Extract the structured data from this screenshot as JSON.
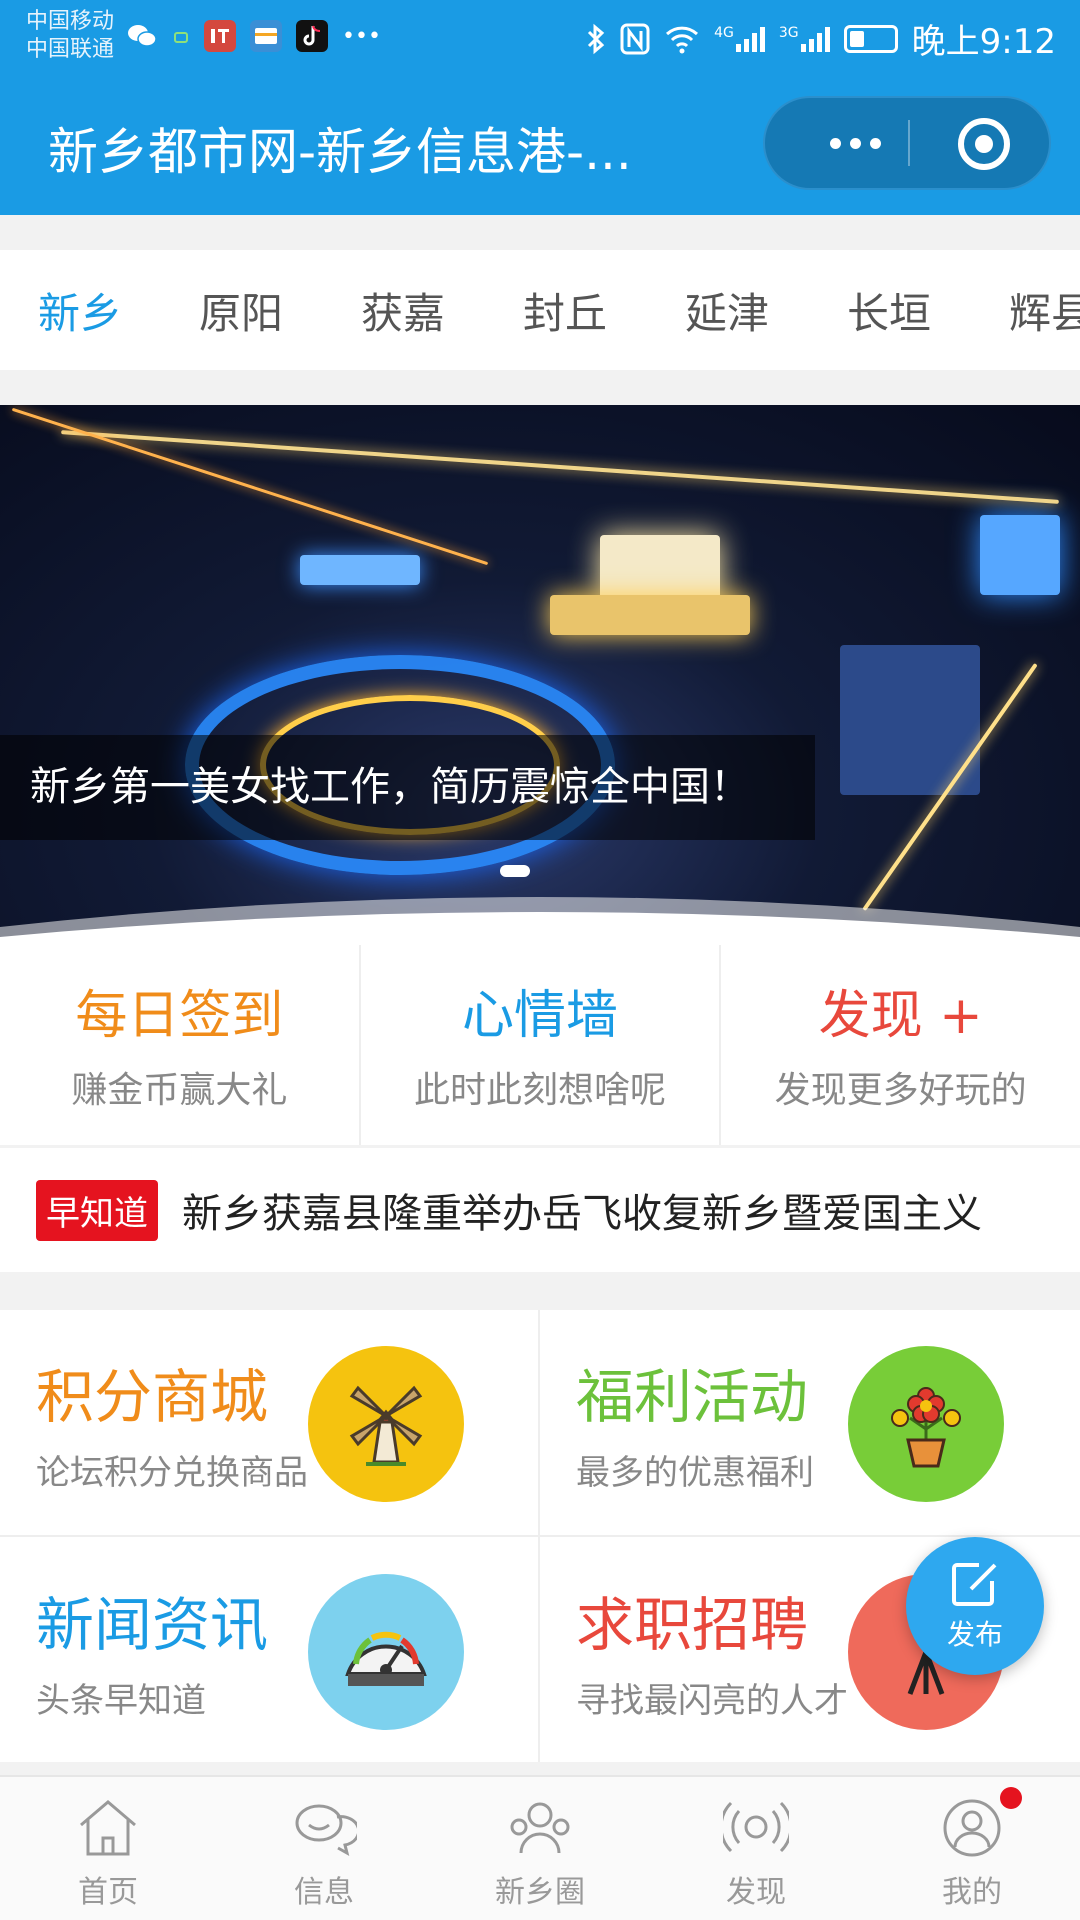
{
  "status_bar": {
    "carrier_1": "中国移动",
    "carrier_2": "中国联通",
    "icons": [
      "wechat-icon",
      "listen-icon",
      "card-icon",
      "tiktok-icon",
      "more-icon"
    ],
    "net_1": "4G",
    "net_2": "3G",
    "time": "晚上9:12"
  },
  "header": {
    "title": "新乡都市网-新乡信息港-...",
    "color": "#1a9be4"
  },
  "tabs": [
    "新乡",
    "原阳",
    "获嘉",
    "封丘",
    "延津",
    "长垣",
    "辉县"
  ],
  "banner": {
    "caption": "新乡第一美女找工作，简历震惊全中国！"
  },
  "quick_actions": [
    {
      "title": "每日签到",
      "subtitle": "赚金币赢大礼",
      "color": "#f08c1a"
    },
    {
      "title": "心情墙",
      "subtitle": "此时此刻想啥呢",
      "color": "#1a9be4"
    },
    {
      "title": "发现 +",
      "subtitle": "发现更多好玩的",
      "color": "#e8483c"
    }
  ],
  "ticker": {
    "badge": "早知道",
    "text": "新乡获嘉县隆重举办岳飞收复新乡暨爱国主义"
  },
  "features": [
    {
      "title": "积分商城",
      "subtitle": "论坛积分兑换商品",
      "color": "#f08c1a",
      "icon": "windmill-icon",
      "icon_bg": "#f5c30f"
    },
    {
      "title": "福利活动",
      "subtitle": "最多的优惠福利",
      "color": "#6cc13b",
      "icon": "flower-pot-icon",
      "icon_bg": "#78cd38"
    },
    {
      "title": "新闻资讯",
      "subtitle": "头条早知道",
      "color": "#1a9be4",
      "icon": "gauge-icon",
      "icon_bg": "#7dd1ee"
    },
    {
      "title": "求职招聘",
      "subtitle": "寻找最闪亮的人才",
      "color": "#e8483c",
      "icon": "easel-icon",
      "icon_bg": "#ef6a5b"
    }
  ],
  "fab": {
    "label": "发布"
  },
  "bottom_nav": [
    {
      "label": "首页",
      "icon": "home-icon"
    },
    {
      "label": "信息",
      "icon": "chat-icon"
    },
    {
      "label": "新乡圈",
      "icon": "group-icon"
    },
    {
      "label": "发现",
      "icon": "broadcast-icon"
    },
    {
      "label": "我的",
      "icon": "profile-icon"
    }
  ]
}
